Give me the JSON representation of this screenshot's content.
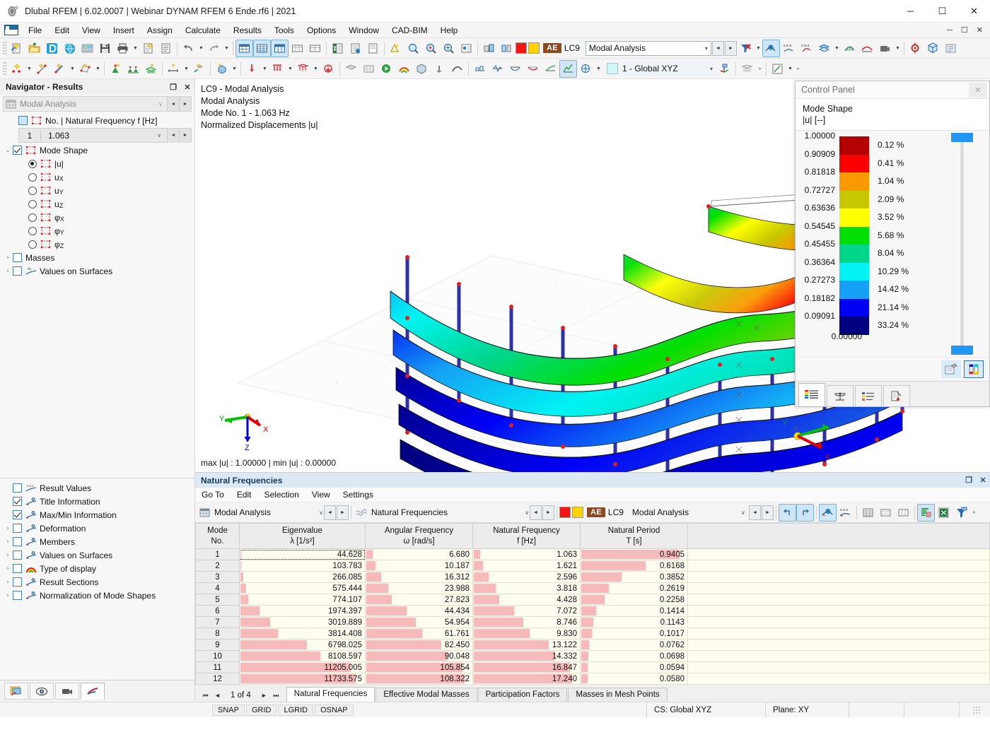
{
  "window": {
    "title": "Dlubal RFEM | 6.02.0007 | Webinar DYNAM RFEM 6 Ende.rf6 | 2021",
    "minimize": "─",
    "maximize": "☐",
    "close": "✕"
  },
  "menu": {
    "items": [
      "File",
      "Edit",
      "View",
      "Insert",
      "Assign",
      "Calculate",
      "Results",
      "Tools",
      "Options",
      "Window",
      "CAD-BIM",
      "Help"
    ],
    "right": [
      "─",
      "☐",
      "✕"
    ]
  },
  "toolbar1": {
    "load_case": {
      "tag": "AE",
      "code": "LC9",
      "value": "Modal Analysis",
      "caret": "▾",
      "prev": "◄",
      "next": "►"
    }
  },
  "toolbar2": {
    "cs_selector": {
      "value": "1 - Global XYZ",
      "caret": "▾"
    },
    "overflow": "»"
  },
  "navigator": {
    "header": {
      "title": "Navigator - Results",
      "restore": "❐",
      "close": "✕"
    },
    "analysis_combo": {
      "value": "Modal Analysis",
      "caret": "∨",
      "prev": "◄",
      "next": "►"
    },
    "frequency_group_label": "No. | Natural Frequency f [Hz]",
    "frequency_row": {
      "no": "1",
      "value": "1.063",
      "caret": "∨",
      "prev": "◄",
      "next": "►"
    },
    "mode_shape_label": "Mode Shape",
    "mode_components": [
      {
        "label": "|u|",
        "selected": true
      },
      {
        "label": "u",
        "sub": "X",
        "selected": false
      },
      {
        "label": "u",
        "sub": "Y",
        "selected": false
      },
      {
        "label": "u",
        "sub": "Z",
        "selected": false
      },
      {
        "label": "φ",
        "sub": "X",
        "selected": false
      },
      {
        "label": "φ",
        "sub": "Y",
        "selected": false
      },
      {
        "label": "φ",
        "sub": "Z",
        "selected": false
      }
    ],
    "extra_items": [
      {
        "label": "Masses",
        "checked": false,
        "expandable": true
      },
      {
        "label": "Values on Surfaces",
        "checked": false,
        "expandable": true,
        "icon": "xx-surface-icon"
      }
    ],
    "display_items": [
      {
        "label": "Result Values",
        "checked": false,
        "expandable": false,
        "icon": "xxx-values-icon"
      },
      {
        "label": "Title Information",
        "checked": true,
        "expandable": false,
        "icon": "display-icon"
      },
      {
        "label": "Max/Min Information",
        "checked": true,
        "expandable": false,
        "icon": "display-icon"
      },
      {
        "label": "Deformation",
        "checked": false,
        "expandable": true,
        "icon": "display-icon"
      },
      {
        "label": "Members",
        "checked": false,
        "expandable": true,
        "icon": "display-icon"
      },
      {
        "label": "Values on Surfaces",
        "checked": false,
        "expandable": true,
        "icon": "display-icon"
      },
      {
        "label": "Type of display",
        "checked": false,
        "expandable": true,
        "icon": "rainbow-icon"
      },
      {
        "label": "Result Sections",
        "checked": false,
        "expandable": true,
        "icon": "display-icon"
      },
      {
        "label": "Normalization of Mode Shapes",
        "checked": false,
        "expandable": true,
        "icon": "display-icon"
      }
    ],
    "bottom_buttons": [
      "render-view-icon",
      "eye-visibility-icon",
      "camera-icon",
      "results-diagram-icon"
    ]
  },
  "viewport": {
    "title_lines": [
      "LC9 - Modal Analysis",
      "Modal Analysis",
      "Mode No. 1 - 1.063 Hz",
      "Normalized Displacements |u|"
    ],
    "max_min": "max |u| : 1.00000 | min |u| : 0.00000",
    "axes": {
      "x": "X",
      "y": "Y",
      "z": "Z"
    },
    "navcube_face": "-X"
  },
  "control_panel": {
    "title": "Control Panel",
    "close": "✕",
    "subtitle_line1": "Mode Shape",
    "subtitle_line2": "|u| [--]",
    "scale_values": [
      "1.00000",
      "0.90909",
      "0.81818",
      "0.72727",
      "0.63636",
      "0.54545",
      "0.45455",
      "0.36364",
      "0.27273",
      "0.18182",
      "0.09091",
      "0.00000"
    ],
    "bands": [
      {
        "color": "#b50000",
        "percent": "0.12 %"
      },
      {
        "color": "#fb0000",
        "percent": "0.41 %"
      },
      {
        "color": "#fa9a00",
        "percent": "1.04 %"
      },
      {
        "color": "#c8c800",
        "percent": "2.09 %"
      },
      {
        "color": "#ffff00",
        "percent": "3.52 %"
      },
      {
        "color": "#00e000",
        "percent": "5.68 %"
      },
      {
        "color": "#00d68a",
        "percent": "8.04 %"
      },
      {
        "color": "#00f3f3",
        "percent": "10.29 %"
      },
      {
        "color": "#15a0f5",
        "percent": "14.42 %"
      },
      {
        "color": "#0000f5",
        "percent": "21.14 %"
      },
      {
        "color": "#000080",
        "percent": "33.24 %"
      }
    ],
    "slider_color": "#2196f3",
    "tool_buttons": [
      "color-picker-icon",
      "color-scale-icon"
    ],
    "tabs": [
      "color-legend-tab-icon",
      "scale-balance-tab-icon",
      "list-legend-tab-icon",
      "factors-tab-icon"
    ]
  },
  "table_panel": {
    "title": "Natural Frequencies",
    "restore": "❐",
    "close": "✕",
    "menu": [
      "Go To",
      "Edit",
      "Selection",
      "View",
      "Settings"
    ],
    "combo_left": {
      "value": "Modal Analysis",
      "caret": "∨",
      "prev": "◄",
      "next": "►"
    },
    "combo_mid": {
      "value": "Natural Frequencies",
      "caret": "∨",
      "prev": "◄",
      "next": "►"
    },
    "load_case": {
      "tag": "AE",
      "code": "LC9",
      "value": "Modal Analysis",
      "caret": "∨",
      "prev": "◄",
      "next": "►"
    },
    "overflow": "»",
    "columns": [
      {
        "title": "Mode",
        "unit": "No."
      },
      {
        "title": "Eigenvalue",
        "unit": "λ [1/s²]"
      },
      {
        "title": "Angular Frequency",
        "unit": "ω [rad/s]"
      },
      {
        "title": "Natural Frequency",
        "unit": "f [Hz]"
      },
      {
        "title": "Natural Period",
        "unit": "T [s]"
      }
    ],
    "pager": {
      "first": "⏮",
      "prev": "◄",
      "text": "1 of 4",
      "next": "►",
      "last": "⏭"
    },
    "tabs": [
      {
        "label": "Natural Frequencies",
        "selected": true
      },
      {
        "label": "Effective Modal Masses",
        "selected": false
      },
      {
        "label": "Participation Factors",
        "selected": false
      },
      {
        "label": "Masses in Mesh Points",
        "selected": false
      }
    ]
  },
  "chart_data": {
    "type": "table",
    "title": "Natural Frequencies",
    "columns": [
      "Mode No.",
      "Eigenvalue λ [1/s²]",
      "Angular Frequency ω [rad/s]",
      "Natural Frequency f [Hz]",
      "Natural Period T [s]"
    ],
    "rows": [
      {
        "mode": "1",
        "eigenvalue": "44.628",
        "angular": "6.680",
        "frequency": "1.063",
        "period": "0.9405",
        "eig_bar": 0.4,
        "ang_bar": 6.2,
        "freq_bar": 6.2,
        "per_bar": 100
      },
      {
        "mode": "2",
        "eigenvalue": "103.783",
        "angular": "10.187",
        "frequency": "1.621",
        "period": "0.6168",
        "eig_bar": 0.9,
        "ang_bar": 9.4,
        "freq_bar": 9.4,
        "per_bar": 65.6
      },
      {
        "mode": "3",
        "eigenvalue": "266.085",
        "angular": "16.312",
        "frequency": "2.596",
        "period": "0.3852",
        "eig_bar": 2.3,
        "ang_bar": 15.1,
        "freq_bar": 15.1,
        "per_bar": 41.0
      },
      {
        "mode": "4",
        "eigenvalue": "575.444",
        "angular": "23.988",
        "frequency": "3.818",
        "period": "0.2619",
        "eig_bar": 4.9,
        "ang_bar": 22.1,
        "freq_bar": 22.1,
        "per_bar": 27.8
      },
      {
        "mode": "5",
        "eigenvalue": "774.107",
        "angular": "27.823",
        "frequency": "4.428",
        "period": "0.2258",
        "eig_bar": 6.6,
        "ang_bar": 25.7,
        "freq_bar": 25.7,
        "per_bar": 24.0
      },
      {
        "mode": "6",
        "eigenvalue": "1974.397",
        "angular": "44.434",
        "frequency": "7.072",
        "period": "0.1414",
        "eig_bar": 16.8,
        "ang_bar": 41.0,
        "freq_bar": 41.0,
        "per_bar": 15.0
      },
      {
        "mode": "7",
        "eigenvalue": "3019.889",
        "angular": "54.954",
        "frequency": "8.746",
        "period": "0.1143",
        "eig_bar": 25.7,
        "ang_bar": 50.7,
        "freq_bar": 50.7,
        "per_bar": 12.2
      },
      {
        "mode": "8",
        "eigenvalue": "3814.408",
        "angular": "61.761",
        "frequency": "9.830",
        "period": "0.1017",
        "eig_bar": 32.5,
        "ang_bar": 57.0,
        "freq_bar": 57.0,
        "per_bar": 10.8
      },
      {
        "mode": "9",
        "eigenvalue": "6798.025",
        "angular": "82.450",
        "frequency": "13.122",
        "period": "0.0762",
        "eig_bar": 57.9,
        "ang_bar": 76.1,
        "freq_bar": 76.1,
        "per_bar": 8.1
      },
      {
        "mode": "10",
        "eigenvalue": "8108.597",
        "angular": "90.048",
        "frequency": "14.332",
        "period": "0.0698",
        "eig_bar": 69.1,
        "ang_bar": 83.1,
        "freq_bar": 83.1,
        "per_bar": 7.4
      },
      {
        "mode": "11",
        "eigenvalue": "11205.005",
        "angular": "105.854",
        "frequency": "16.847",
        "period": "0.0594",
        "eig_bar": 95.5,
        "ang_bar": 97.7,
        "freq_bar": 97.7,
        "per_bar": 6.3
      },
      {
        "mode": "12",
        "eigenvalue": "11733.575",
        "angular": "108.322",
        "frequency": "17.240",
        "period": "0.0580",
        "eig_bar": 100,
        "ang_bar": 100,
        "freq_bar": 100,
        "per_bar": 6.2
      }
    ],
    "bar_color": "#f7b9b9"
  },
  "statusbar": {
    "toggles": [
      "SNAP",
      "GRID",
      "LGRID",
      "OSNAP"
    ],
    "cs": "CS: Global XYZ",
    "plane": "Plane: XY"
  }
}
